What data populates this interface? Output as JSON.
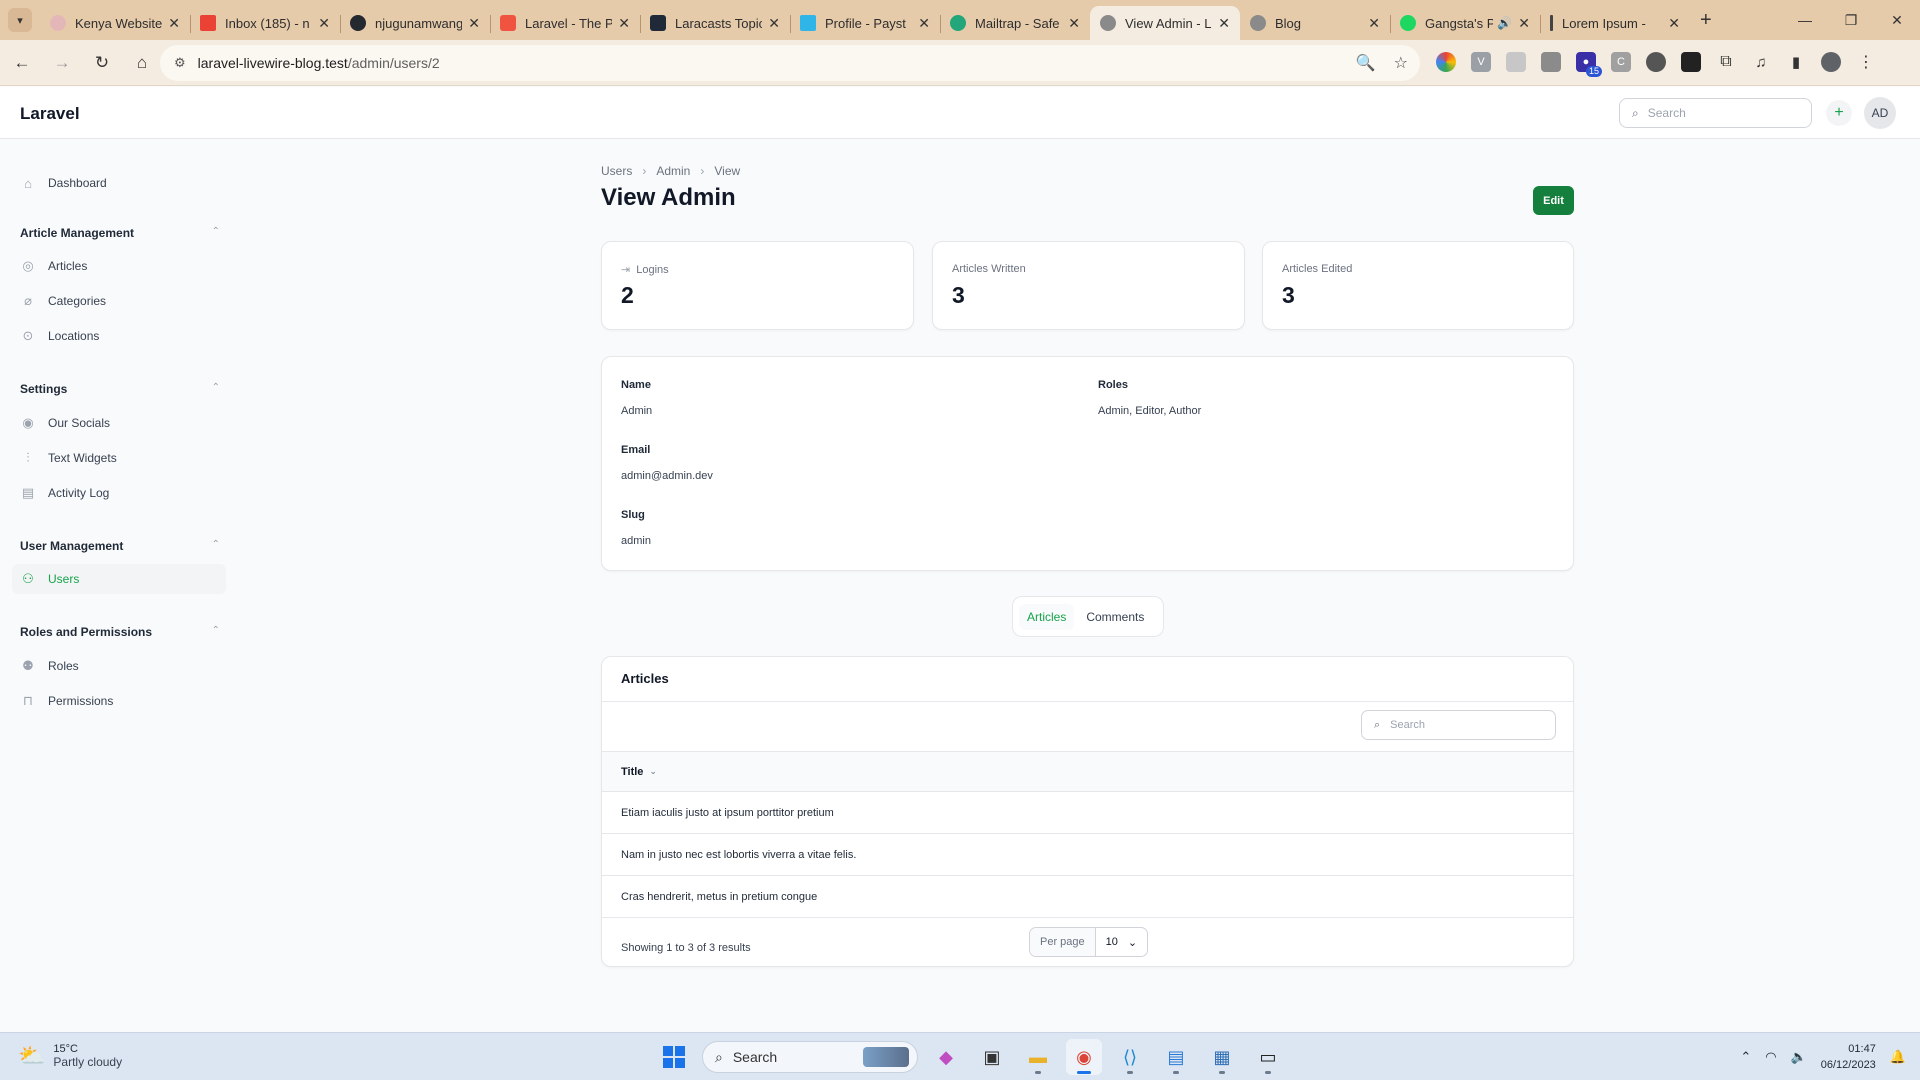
{
  "browser": {
    "tabs": [
      {
        "title": "Kenya Website",
        "favicon_color": "#e3b7b7"
      },
      {
        "title": "Inbox (185) - n",
        "favicon_color": "#ea4335"
      },
      {
        "title": "njugunamwang",
        "favicon_color": "#24292f"
      },
      {
        "title": "Laravel - The P",
        "favicon_color": "#f05340"
      },
      {
        "title": "Laracasts Topic",
        "favicon_color": "#1f2937"
      },
      {
        "title": "Profile - Payst",
        "favicon_color": "#2fb5e8"
      },
      {
        "title": "Mailtrap - Safe",
        "favicon_color": "#22a67a"
      },
      {
        "title": "View Admin - L",
        "favicon_color": "#8a8a8a",
        "active": true
      },
      {
        "title": "Blog",
        "favicon_color": "#8a8a8a"
      },
      {
        "title": "Gangsta's P",
        "favicon_color": "#1ed760",
        "audio": true
      },
      {
        "title": "Lorem Ipsum -",
        "favicon_color": "#444444"
      }
    ],
    "url_host": "laravel-livewire-blog.test",
    "url_path": "/admin/users/2"
  },
  "app": {
    "brand": "Laravel",
    "search_placeholder": "Search",
    "avatar_initials": "AD",
    "accent_color": "#16a34a"
  },
  "sidebar": {
    "dashboard": "Dashboard",
    "groups": [
      {
        "label": "Article Management",
        "items": [
          "Articles",
          "Categories",
          "Locations"
        ]
      },
      {
        "label": "Settings",
        "items": [
          "Our Socials",
          "Text Widgets",
          "Activity Log"
        ]
      },
      {
        "label": "User Management",
        "items": [
          "Users"
        ]
      },
      {
        "label": "Roles and Permissions",
        "items": [
          "Roles",
          "Permissions"
        ]
      }
    ]
  },
  "page": {
    "breadcrumbs": [
      "Users",
      "Admin",
      "View"
    ],
    "title": "View Admin",
    "edit_label": "Edit",
    "stats": [
      {
        "label": "Logins",
        "value": "2"
      },
      {
        "label": "Articles Written",
        "value": "3"
      },
      {
        "label": "Articles Edited",
        "value": "3"
      }
    ],
    "info": {
      "name_label": "Name",
      "name": "Admin",
      "roles_label": "Roles",
      "roles": "Admin, Editor, Author",
      "email_label": "Email",
      "email": "admin@admin.dev",
      "slug_label": "Slug",
      "slug": "admin"
    },
    "tabs": [
      "Articles",
      "Comments"
    ],
    "table": {
      "title": "Articles",
      "search_placeholder": "Search",
      "column": "Title",
      "rows": [
        "Etiam iaculis justo at ipsum porttitor pretium",
        "Nam in justo nec est lobortis viverra a vitae felis.",
        "Cras hendrerit, metus in pretium congue"
      ],
      "summary": "Showing 1 to 3 of 3 results",
      "per_page_label": "Per page",
      "per_page": "10"
    }
  },
  "taskbar": {
    "temperature": "15°C",
    "weather": "Partly cloudy",
    "search": "Search",
    "time": "01:47",
    "date": "06/12/2023"
  }
}
